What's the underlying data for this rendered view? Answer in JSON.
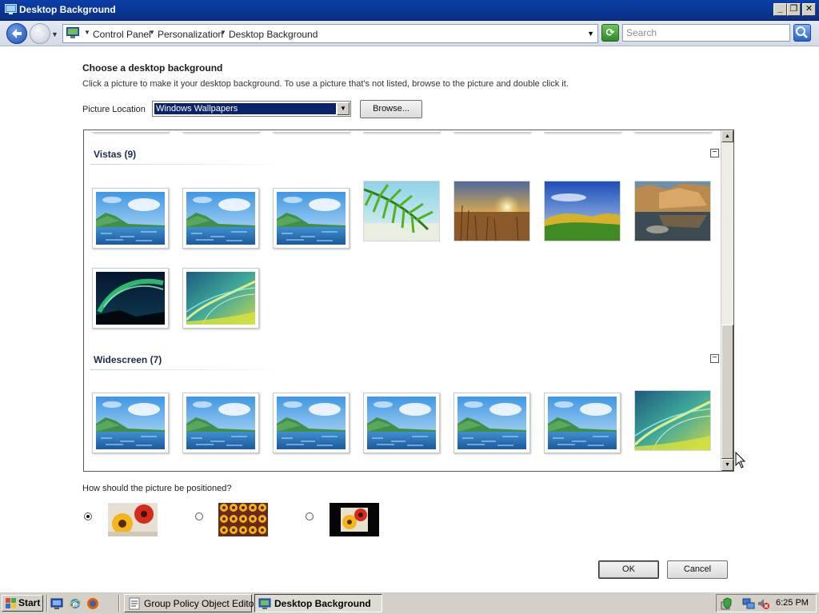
{
  "window": {
    "title": "Desktop Background",
    "controls": {
      "minimize": "_",
      "maximize": "❐",
      "close": "✕"
    }
  },
  "address": {
    "breadcrumbs": [
      "Control Panel",
      "Personalization",
      "Desktop Background"
    ],
    "search_placeholder": "Search"
  },
  "page": {
    "heading": "Choose a desktop background",
    "instructions": "Click a picture to make it your desktop background. To use a picture that's not listed, browse to the picture and double click it.",
    "location_label": "Picture Location",
    "location_value": "Windows Wallpapers",
    "browse_label": "Browse...",
    "groups": [
      {
        "title": "Vistas (9)",
        "collapse_symbol": "−",
        "items": [
          "vista-lake",
          "vista-lake",
          "vista-lake",
          "palm-frond",
          "sunset-field",
          "green-hills",
          "rock-reflection",
          "aurora",
          "vista-waves"
        ]
      },
      {
        "title": "Widescreen (7)",
        "collapse_symbol": "−",
        "items": [
          "vista-lake",
          "vista-lake",
          "vista-lake",
          "vista-lake",
          "vista-lake",
          "vista-lake",
          "vista-waves"
        ]
      }
    ],
    "position_question": "How should the picture be positioned?",
    "position_options": [
      {
        "name": "fit-to-screen",
        "selected": true
      },
      {
        "name": "tile",
        "selected": false
      },
      {
        "name": "center",
        "selected": false
      }
    ],
    "ok_label": "OK",
    "cancel_label": "Cancel"
  },
  "taskbar": {
    "start_label": "Start",
    "tasks": [
      {
        "label": "Group Policy Object Editor",
        "active": false
      },
      {
        "label": "Desktop Background",
        "active": true
      }
    ],
    "clock": "6:25 PM"
  },
  "colors": {
    "titlebar": "#0b3fa8",
    "selection": "#0a246a",
    "chrome": "#d4d0c8"
  },
  "icons": [
    "back-arrow-icon",
    "forward-arrow-icon",
    "control-panel-icon",
    "refresh-icon",
    "search-icon",
    "windows-flag-icon",
    "show-desktop-icon",
    "internet-explorer-icon",
    "firefox-icon",
    "network-icon",
    "volume-muted-icon"
  ]
}
